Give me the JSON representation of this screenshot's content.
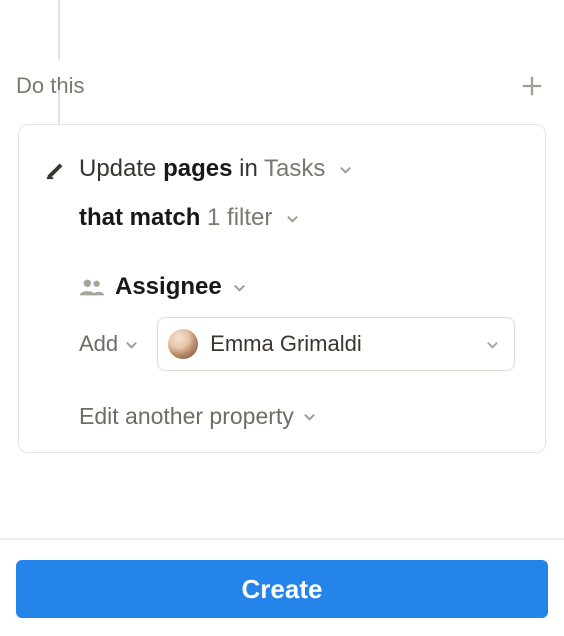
{
  "section": {
    "title": "Do this"
  },
  "action": {
    "verb": "Update",
    "object": "pages",
    "in_label": "in",
    "target": "Tasks",
    "match_prefix": "that match",
    "filter_label": "1 filter"
  },
  "property": {
    "name": "Assignee",
    "operation": "Add",
    "value": "Emma Grimaldi"
  },
  "links": {
    "edit_another": "Edit another property"
  },
  "buttons": {
    "create": "Create"
  },
  "icons": {
    "plus": "plus-icon",
    "pencil": "pencil-icon",
    "people": "people-icon",
    "chevron": "chevron-down-icon"
  }
}
